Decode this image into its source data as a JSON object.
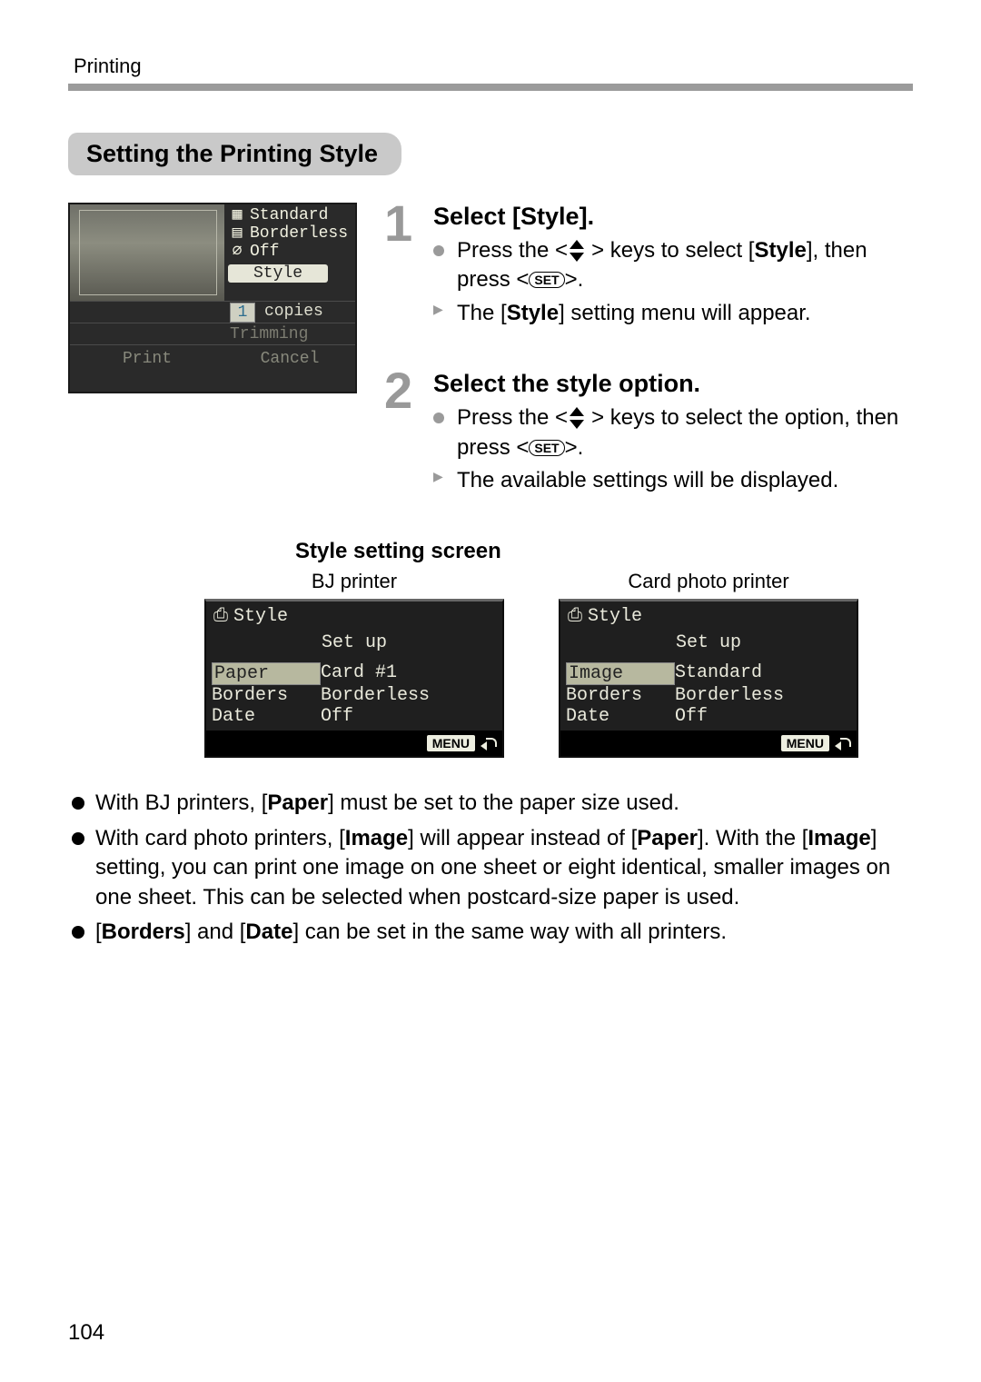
{
  "header": {
    "section": "Printing"
  },
  "section_title": "Setting the Printing Style",
  "page_number": "104",
  "camera_preview": {
    "lines": [
      {
        "icon": "▦",
        "text": "Standard"
      },
      {
        "icon": "▤",
        "text": "Borderless"
      },
      {
        "icon": "⌀",
        "text": "Off"
      }
    ],
    "style_button": "Style",
    "copies_count": "1",
    "copies_label": "copies",
    "trimming": "Trimming",
    "print": "Print",
    "cancel": "Cancel"
  },
  "steps": [
    {
      "num": "1",
      "title": "Select [Style].",
      "press_prefix": "Press the <",
      "press_mid": "> keys to select [",
      "press_target": "Style",
      "press_suffix1": "], then press <",
      "set_label": "SET",
      "press_suffix2": ">.",
      "result_prefix": "The [",
      "result_target": "Style",
      "result_suffix": "] setting menu will appear."
    },
    {
      "num": "2",
      "title": "Select the style option.",
      "press_prefix": "Press the <",
      "press_mid": "> keys to select the option, then press <",
      "set_label": "SET",
      "press_suffix2": ">.",
      "result": "The available settings will be displayed."
    }
  ],
  "style_screens": {
    "heading": "Style setting screen",
    "screens": [
      {
        "caption": "BJ printer",
        "icon": "⎙",
        "title": "Style",
        "subtitle": "Set up",
        "rows": [
          {
            "k": "Paper",
            "v": "Card #1",
            "selected": true
          },
          {
            "k": "Borders",
            "v": "Borderless"
          },
          {
            "k": "Date",
            "v": "Off"
          }
        ],
        "menu": "MENU"
      },
      {
        "caption": "Card photo printer",
        "icon": "⎙",
        "title": "Style",
        "subtitle": "Set up",
        "rows": [
          {
            "k": "Image",
            "v": "Standard",
            "selected": true
          },
          {
            "k": "Borders",
            "v": "Borderless"
          },
          {
            "k": "Date",
            "v": "Off"
          }
        ],
        "menu": "MENU"
      }
    ]
  },
  "notes": {
    "n1_a": "With BJ printers, [",
    "n1_b": "Paper",
    "n1_c": "] must be set to the paper size used.",
    "n2_a": "With card photo printers, [",
    "n2_b": "Image",
    "n2_c": "] will appear instead of [",
    "n2_d": "Paper",
    "n2_e": "]. With the [",
    "n2_f": "Image",
    "n2_g": "] setting, you can print one image on one sheet or eight identical, smaller images on one sheet. This can be selected when postcard-size paper is used.",
    "n3_a": "[",
    "n3_b": "Borders",
    "n3_c": "] and [",
    "n3_d": "Date",
    "n3_e": "] can be set in the same way with all printers."
  }
}
